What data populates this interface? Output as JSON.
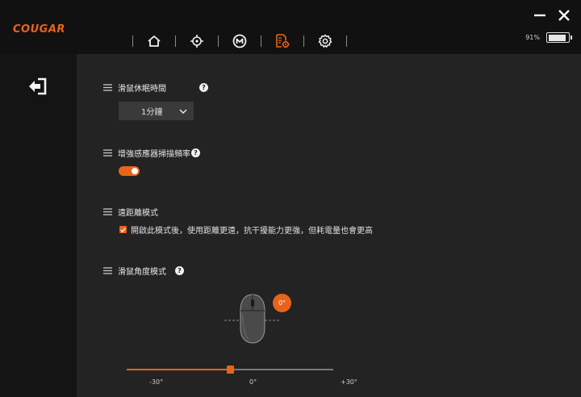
{
  "app": {
    "logo": "COUGAR"
  },
  "nav": {
    "items": [
      {
        "name": "home-icon"
      },
      {
        "name": "dpi-target-icon"
      },
      {
        "name": "macro-icon"
      },
      {
        "name": "settings-doc-icon",
        "active": true
      },
      {
        "name": "gear-icon"
      }
    ]
  },
  "window": {
    "minimize": "minimize-icon",
    "close": "close-icon"
  },
  "battery": {
    "percent_text": "91%",
    "level": 0.91
  },
  "sections": {
    "sleep": {
      "title": "滑鼠休眠時間",
      "dropdown_value": "1分鐘"
    },
    "polling": {
      "title": "增強感應器掃描頻率",
      "enabled": true
    },
    "lod": {
      "title": "遠距離模式",
      "checkbox_label": "開啟此模式後，使用距離更遠，抗干擾能力更強，但耗電量也會更高",
      "checked": true
    },
    "angle": {
      "title": "滑鼠角度模式",
      "badge": "0°",
      "value": 0,
      "min_label": "-30°",
      "mid_label": "0°",
      "max_label": "+30°",
      "min": -30,
      "max": 30
    }
  },
  "colors": {
    "accent": "#e8641a",
    "background": "#232323",
    "topbar": "#111111"
  }
}
